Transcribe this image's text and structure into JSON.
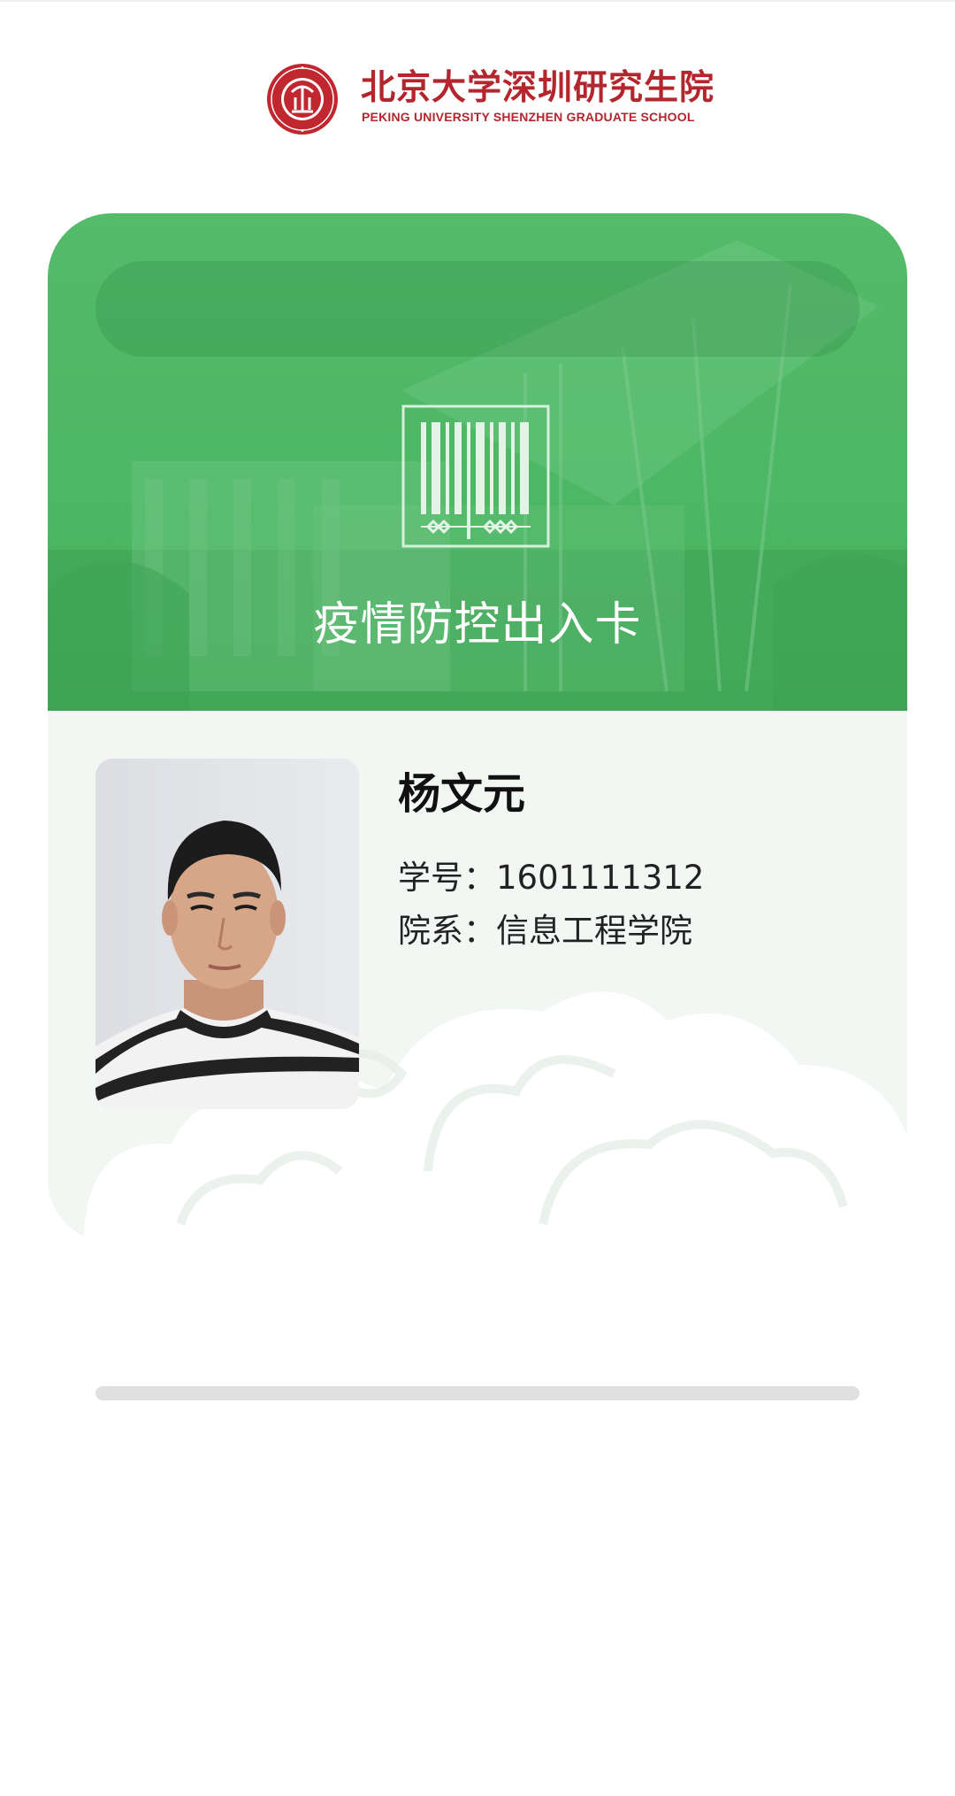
{
  "header": {
    "logo_cn": "北京大学深圳研究生院",
    "logo_en": "PEKING UNIVERSITY SHENZHEN GRADUATE SCHOOL",
    "brand_color": "#b3262d"
  },
  "card": {
    "title": "疫情防控出入卡",
    "accent_color": "#4cb764",
    "icon": "barcode-icon"
  },
  "person": {
    "name": "杨文元",
    "id_label": "学号：",
    "id_value": "1601111312",
    "dept_label": "院系：",
    "dept_value": "信息工程学院"
  },
  "progress": {
    "value": 0
  }
}
